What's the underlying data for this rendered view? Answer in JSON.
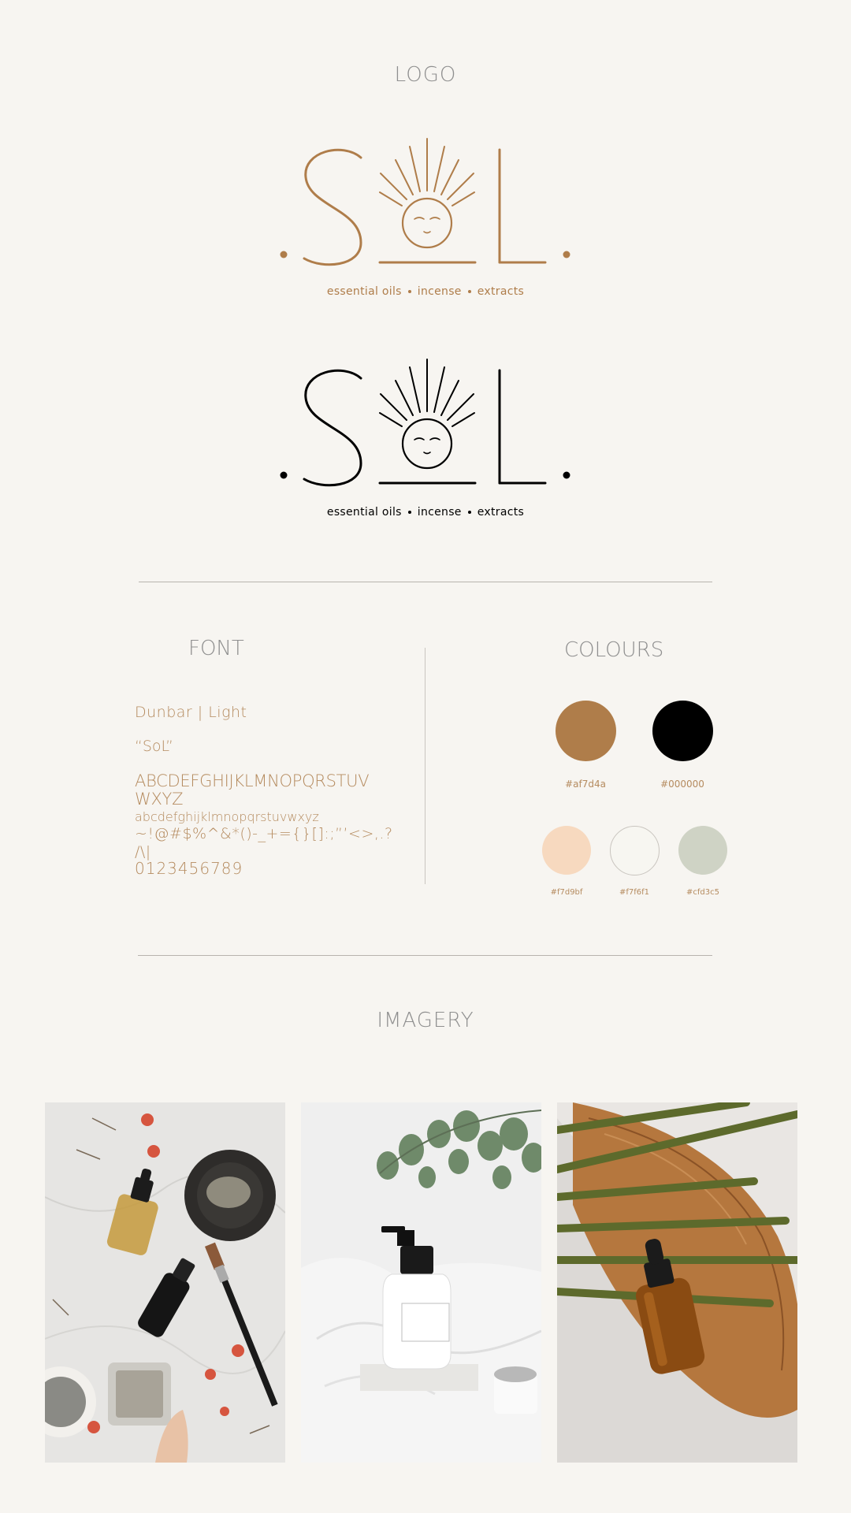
{
  "sections": {
    "logo_title": "LOGO",
    "font_title": "FONT",
    "colours_title": "COLOURS",
    "imagery_title": "IMAGERY"
  },
  "logo": {
    "wordmark": ".SoL.",
    "tagline": {
      "part1": "essential oils",
      "part2": "incense",
      "part3": "extracts"
    },
    "variants": [
      "brand-colour",
      "black"
    ],
    "brand_color": "#af7d4a",
    "black_color": "#000000"
  },
  "font": {
    "name": "Dunbar | Light",
    "sample_quote": "“SoL”",
    "uppercase": "ABCDEFGHIJKLMNOPQRSTUV WXYZ",
    "lowercase": "abcdefghijklmnopqrstuvwxyz",
    "symbols": "~!@#$%^&*()-_+={}[]:;”’<>,.? /\\|",
    "numbers": "0123456789"
  },
  "colours": {
    "primary": [
      {
        "hex": "#af7d4a",
        "label": "#af7d4a"
      },
      {
        "hex": "#000000",
        "label": "#000000"
      }
    ],
    "secondary": [
      {
        "hex": "#f7d9bf",
        "label": "#f7d9bf"
      },
      {
        "hex": "#f7f6f1",
        "label": "#f7f6f1"
      },
      {
        "hex": "#cfd3c5",
        "label": "#cfd3c5"
      }
    ]
  },
  "imagery": [
    {
      "subject": "dropper bottles, clay bowl, brush and dried flowers on marble"
    },
    {
      "subject": "white pump bottle with eucalyptus on white fabric"
    },
    {
      "subject": "amber dropper bottle on wooden board with palm leaves"
    }
  ]
}
